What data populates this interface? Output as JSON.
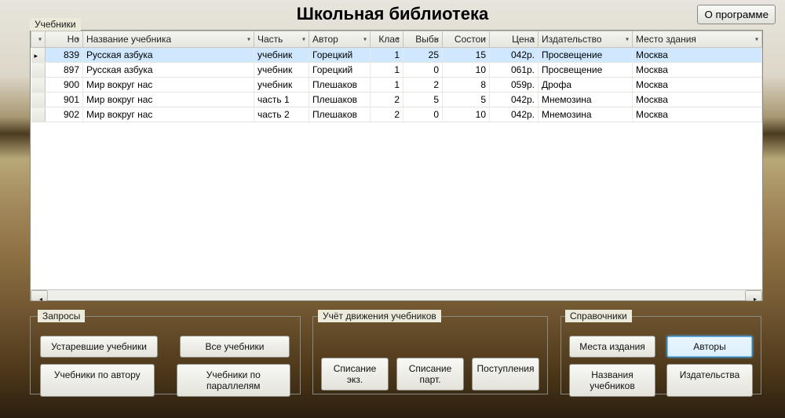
{
  "app": {
    "title": "Школьная библиотека",
    "about_label": "О программе"
  },
  "sections": {
    "textbooks_label": "Учебники",
    "requests_label": "Запросы",
    "movement_label": "Учёт движения учебников",
    "refs_label": "Справочники"
  },
  "table": {
    "headers": {
      "num": "Но",
      "name": "Название учебника",
      "part": "Часть",
      "author": "Автор",
      "class": "Клас",
      "out": "Выбь",
      "stock": "Состои",
      "price": "Цена",
      "publisher": "Издательство",
      "place": "Место здания"
    },
    "rows": [
      {
        "num": "839",
        "name": "Русская азбука",
        "part": "учебник",
        "author": "Горецкий",
        "class": "1",
        "out": "25",
        "stock": "15",
        "price": "042р.",
        "publisher": "Просвещение",
        "place": "Москва"
      },
      {
        "num": "897",
        "name": "Русская азбука",
        "part": "учебник",
        "author": "Горецкий",
        "class": "1",
        "out": "0",
        "stock": "10",
        "price": "061р.",
        "publisher": "Просвещение",
        "place": "Москва"
      },
      {
        "num": "900",
        "name": "Мир вокруг нас",
        "part": "учебник",
        "author": "Плешаков",
        "class": "1",
        "out": "2",
        "stock": "8",
        "price": "059р.",
        "publisher": "Дрофа",
        "place": "Москва"
      },
      {
        "num": "901",
        "name": "Мир вокруг нас",
        "part": "часть 1",
        "author": "Плешаков",
        "class": "2",
        "out": "5",
        "stock": "5",
        "price": "042р.",
        "publisher": "Мнемозина",
        "place": "Москва"
      },
      {
        "num": "902",
        "name": "Мир вокруг нас",
        "part": "часть 2",
        "author": "Плешаков",
        "class": "2",
        "out": "0",
        "stock": "10",
        "price": "042р.",
        "publisher": "Мнемозина",
        "place": "Москва"
      }
    ]
  },
  "requests": {
    "obsolete": "Устаревшие учебники",
    "all": "Все учебники",
    "by_author": "Учебники по автору",
    "by_grade": "Учебники по параллелям"
  },
  "movement": {
    "write_off_copies": "Списание экз.",
    "write_off_batch": "Списание парт.",
    "incoming": "Поступления"
  },
  "refs": {
    "places": "Места издания",
    "authors": "Авторы",
    "titles": "Названия учебников",
    "publishers": "Издательства"
  }
}
